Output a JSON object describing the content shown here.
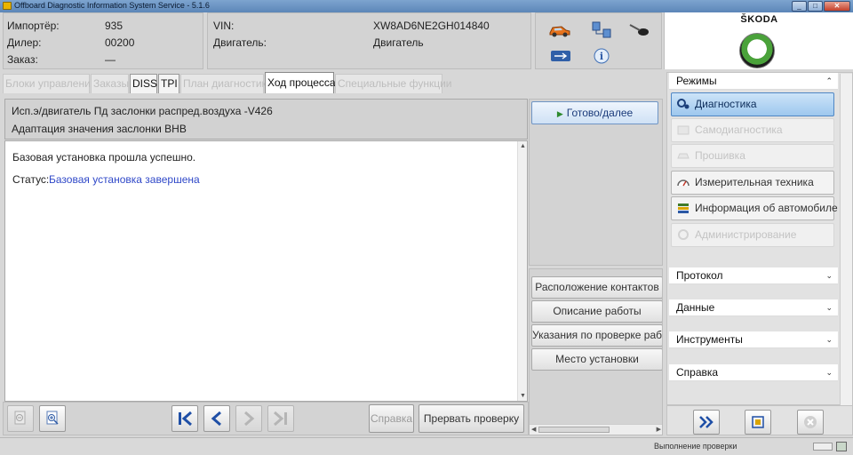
{
  "window": {
    "title": "Offboard Diagnostic Information System Service - 5.1.6"
  },
  "header": {
    "importer_label": "Импортёр:",
    "importer_value": "935",
    "dealer_label": "Дилер:",
    "dealer_value": "00200",
    "order_label": "Заказ:",
    "order_value": "—",
    "vin_label": "VIN:",
    "vin_value": "XW8AD6NE2GH014840",
    "engine_label": "Двигатель:",
    "engine_value": "Двигатель",
    "brand": "ŠKODA"
  },
  "tabs": [
    {
      "label": "Блоки управления",
      "state": "disabled"
    },
    {
      "label": "Заказы",
      "state": "disabled"
    },
    {
      "label": "DISS",
      "state": "enabled"
    },
    {
      "label": "TPI",
      "state": "enabled"
    },
    {
      "label": "План диагностики",
      "state": "disabled"
    },
    {
      "label": "Ход процесса",
      "state": "active"
    },
    {
      "label": "Специальные функции",
      "state": "disabled"
    }
  ],
  "process": {
    "heading_line1": "Исп.э/двигатель Пд заслонки распред.воздуха -V426",
    "heading_line2": "Адаптация значения заслонки ВНВ",
    "message": "Базовая установка прошла успешно.",
    "status_label": "Статус:",
    "status_value": "Базовая установка завершена"
  },
  "middle": {
    "ready_button": "Готово/далее",
    "side_buttons": [
      "Расположение контактов",
      "Описание работы",
      "Указания по проверке рабо",
      "Место установки"
    ]
  },
  "toolbar": {
    "help_label": "Справка",
    "abort_label": "Прервать проверку"
  },
  "right_panel": {
    "modes_title": "Режимы",
    "modes": [
      {
        "label": "Диагностика",
        "state": "active"
      },
      {
        "label": "Самодиагностика",
        "state": "disabled"
      },
      {
        "label": "Прошивка",
        "state": "disabled"
      },
      {
        "label": "Измерительная техника",
        "state": "enabled"
      },
      {
        "label": "Информация об автомобиле",
        "state": "enabled"
      },
      {
        "label": "Администрирование",
        "state": "disabled"
      }
    ],
    "sections": [
      "Протокол",
      "Данные",
      "Инструменты",
      "Справка"
    ]
  },
  "statusbar": {
    "text": "Выполнение проверки"
  },
  "colors": {
    "accent": "#2f48c8",
    "active_mode": "#9dc7ee",
    "go_arrow": "#2e8a2e"
  }
}
